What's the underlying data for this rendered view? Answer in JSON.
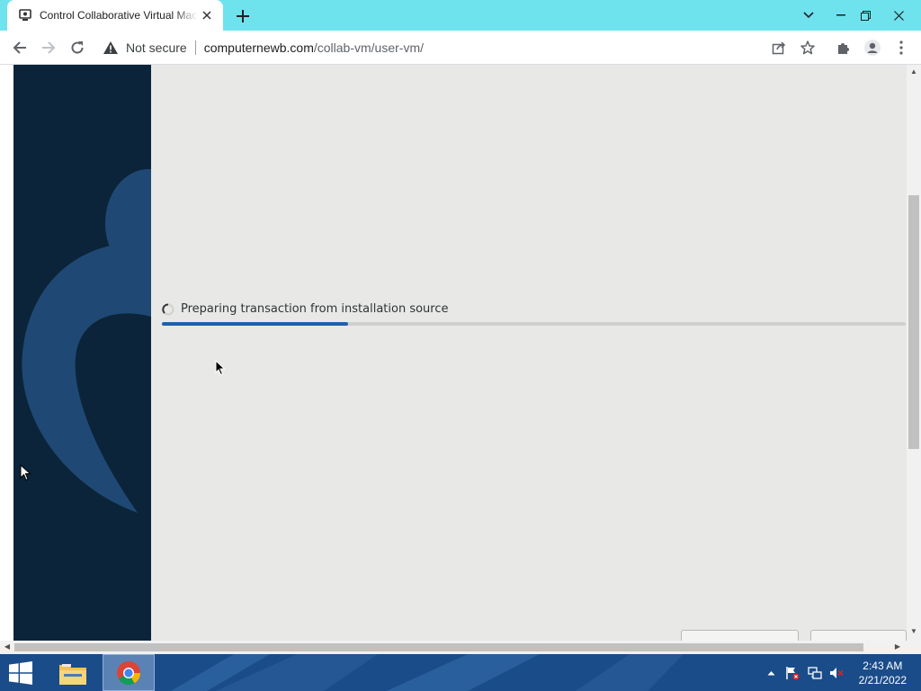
{
  "browser": {
    "tab_title": "Control Collaborative Virtual Machine",
    "security_label": "Not secure",
    "url_host": "computernewb.com",
    "url_path": "/collab-vm/user-vm/"
  },
  "installer": {
    "status_text": "Preparing transaction from installation source",
    "progress_percent": 25
  },
  "taskbar": {
    "time": "2:43 AM",
    "date": "2/21/2022"
  },
  "colors": {
    "titlebar": "#6ee3ee",
    "vm_background": "#e8e8e7",
    "vm_sidebar": "#0b2439",
    "progress_fill": "#1c61b0",
    "taskbar": "#1a4c8a"
  }
}
